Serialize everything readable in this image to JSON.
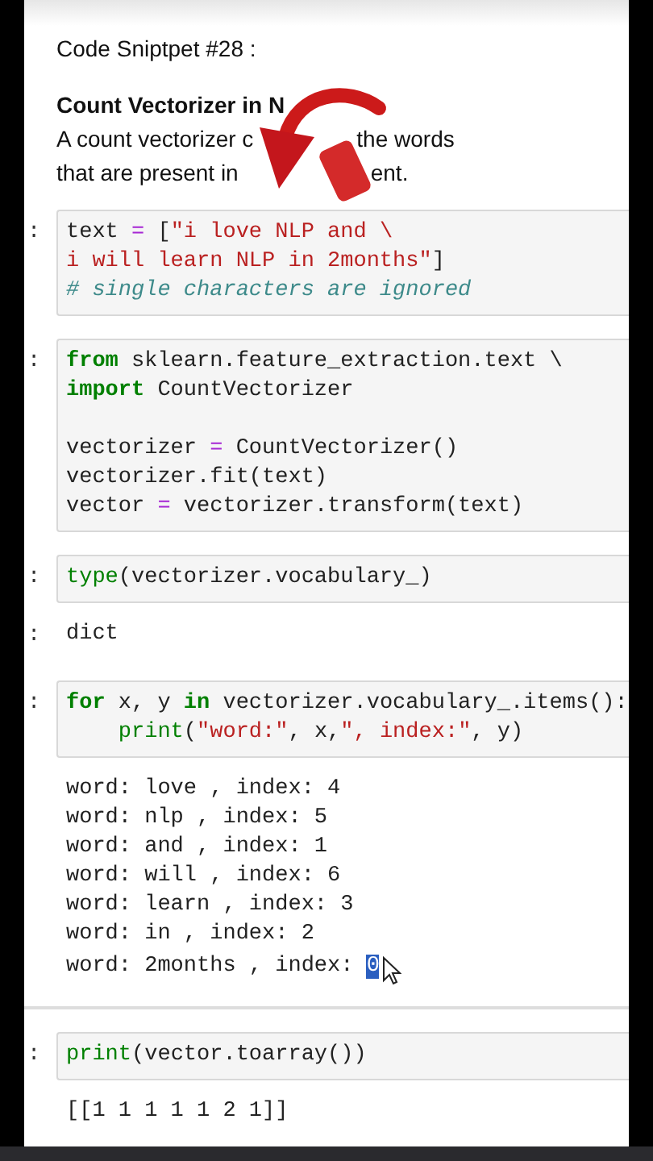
{
  "markdown": {
    "title": "Code Sniptpet #28 :",
    "heading": [
      "Count Vectorizer in N"
    ],
    "lines": [
      [
        "A count vectorizer c",
        "the words"
      ],
      [
        "that are present in",
        "ent."
      ]
    ]
  },
  "cells": [
    {
      "prompt": ":",
      "groups": [
        [
          [
            {
              "kind": "plain",
              "text": "text "
            },
            {
              "kind": "op",
              "text": "="
            },
            {
              "kind": "plain",
              "text": " ["
            },
            {
              "kind": "str",
              "text": "\"i love NLP and \\"
            }
          ],
          [
            {
              "kind": "str",
              "text": "i will learn NLP in 2months\""
            },
            {
              "kind": "plain",
              "text": "]"
            }
          ],
          [
            {
              "kind": "comment",
              "text": "# single characters are ignored"
            }
          ]
        ]
      ]
    },
    {
      "prompt": ":",
      "groups": [
        [
          [
            {
              "kind": "kw",
              "text": "from"
            },
            {
              "kind": "plain",
              "text": " sklearn.feature_extraction.text \\"
            }
          ],
          [
            {
              "kind": "kw",
              "text": "import"
            },
            {
              "kind": "plain",
              "text": " CountVectorizer"
            }
          ]
        ],
        [
          [
            {
              "kind": "plain",
              "text": "vectorizer "
            },
            {
              "kind": "op",
              "text": "="
            },
            {
              "kind": "plain",
              "text": " CountVectorizer()"
            }
          ],
          [
            {
              "kind": "plain",
              "text": "vectorizer.fit(text)"
            }
          ],
          [
            {
              "kind": "plain",
              "text": "vector "
            },
            {
              "kind": "op",
              "text": "="
            },
            {
              "kind": "plain",
              "text": " vectorizer.transform(text)"
            }
          ]
        ]
      ]
    },
    {
      "prompt": ":",
      "groups": [
        [
          [
            {
              "kind": "builtin",
              "text": "type"
            },
            {
              "kind": "plain",
              "text": "(vectorizer.vocabulary_)"
            }
          ]
        ]
      ],
      "output": {
        "prompt": ":",
        "lines": [
          {
            "text": "dict"
          }
        ]
      }
    },
    {
      "prompt": ":",
      "groups": [
        [
          [
            {
              "kind": "kw",
              "text": "for"
            },
            {
              "kind": "plain",
              "text": " x, y "
            },
            {
              "kind": "kw",
              "text": "in"
            },
            {
              "kind": "plain",
              "text": " vectorizer.vocabulary_.items():"
            }
          ],
          [
            {
              "kind": "builtin",
              "text": "    print"
            },
            {
              "kind": "plain",
              "text": "("
            },
            {
              "kind": "str",
              "text": "\"word:\""
            },
            {
              "kind": "plain",
              "text": ", x,"
            },
            {
              "kind": "str",
              "text": "\", index:\""
            },
            {
              "kind": "plain",
              "text": ", y)"
            }
          ]
        ]
      ],
      "output": {
        "lines": [
          {
            "text": "word: love , index: 4"
          },
          {
            "text": "word: nlp , index: 5"
          },
          {
            "text": "word: and , index: 1"
          },
          {
            "text": "word: will , index: 6"
          },
          {
            "text": "word: learn , index: 3"
          },
          {
            "text": "word: in , index: 2"
          },
          {
            "text": "word: 2months , index: ",
            "selection": "0"
          }
        ]
      }
    },
    {
      "prompt": ":",
      "groups": [
        [
          [
            {
              "kind": "builtin",
              "text": "print"
            },
            {
              "kind": "plain",
              "text": "(vector.toarray())"
            }
          ]
        ]
      ],
      "output": {
        "lines": [
          {
            "text": "[[1 1 1 1 1 2 1]]"
          }
        ]
      }
    }
  ]
}
